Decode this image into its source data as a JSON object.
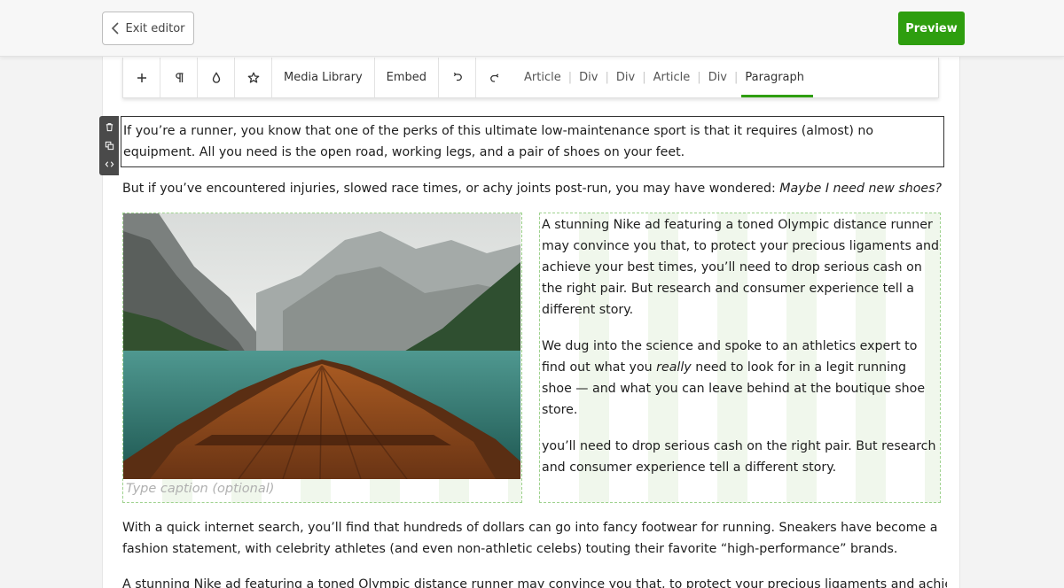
{
  "topbar": {
    "exit_label": "Exit editor",
    "preview_label": "Preview",
    "accent": "#2e9e0f"
  },
  "toolbar": {
    "icons": [
      "plus-icon",
      "pilcrow-icon",
      "droplet-icon",
      "star-icon"
    ],
    "media_library": "Media Library",
    "embed": "Embed",
    "undo_icon": "undo-icon",
    "redo_icon": "redo-icon",
    "breadcrumbs": [
      "Article",
      "Div",
      "Div",
      "Article",
      "Div",
      "Paragraph"
    ],
    "active_crumb": "Paragraph"
  },
  "side_tools": [
    "trash-icon",
    "duplicate-icon",
    "code-icon"
  ],
  "content": {
    "p1": "If you’re a runner, you know that one of the perks of this ultimate low-maintenance sport is that it requires (almost) no equipment. All you need is the open road, working legs, and a pair of shoes on your feet.",
    "p2_plain": "But if you’ve encountered injuries, slowed race times, or achy joints post-run, you may have wondered: ",
    "p2_italic": "Maybe I need new shoes?",
    "image_caption_placeholder": "Type caption (optional)",
    "image_subject": "wooden-boat-on-mountain-lake",
    "col_p1": "A stunning Nike ad featuring a toned Olympic distance runner may convince you that, to protect your precious ligaments and achieve your best times, you’ll need to drop serious cash on the right pair. But research and consumer experience tell a different story.",
    "col_p2_a": "We dug into the science and spoke to an athletics expert to find out what you ",
    "col_p2_em": "really",
    "col_p2_b": " need to look for in a legit running shoe — and what you can leave behind at the boutique shoe store.",
    "col_p3": "you’ll need to drop serious cash on the right pair. But research and consumer experience tell a different story.",
    "p3": "With a quick internet search, you’ll find that hundreds of dollars can go into fancy footwear for running. Sneakers have become a fashion statement, with celebrity athletes (and even non-athletic celebs) touting their favorite “high-performance” brands.",
    "p4": "A stunning Nike ad featuring a toned Olympic distance runner may convince you that, to protect your precious ligaments and achieve"
  }
}
